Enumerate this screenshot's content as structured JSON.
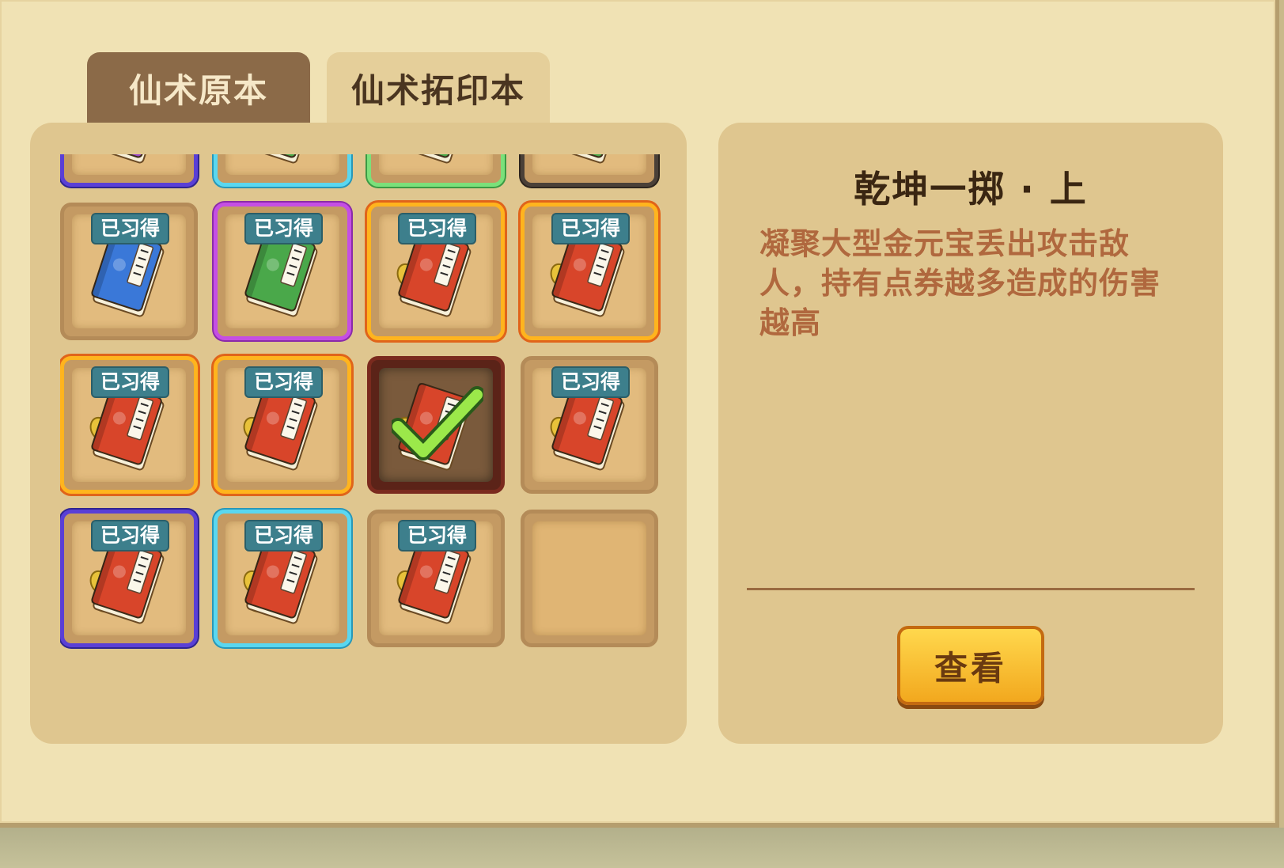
{
  "tabs": [
    {
      "label": "仙术原本",
      "active": true
    },
    {
      "label": "仙术拓印本",
      "active": false
    }
  ],
  "learned_label": "已习得",
  "grid": {
    "slots": [
      {
        "book": "purple",
        "rarity": "purple",
        "learned": false
      },
      {
        "book": "green",
        "rarity": "cyan",
        "learned": false
      },
      {
        "book": "green",
        "rarity": "green",
        "learned": false
      },
      {
        "book": "green",
        "rarity": "dark",
        "learned": false
      },
      {
        "book": "blue",
        "rarity": "none",
        "learned": true
      },
      {
        "book": "green",
        "rarity": "magenta",
        "learned": true
      },
      {
        "book": "red",
        "rarity": "gold",
        "learned": true
      },
      {
        "book": "red",
        "rarity": "gold",
        "learned": true
      },
      {
        "book": "red",
        "rarity": "gold",
        "learned": true
      },
      {
        "book": "red",
        "rarity": "gold",
        "learned": true
      },
      {
        "book": "red",
        "rarity": "none",
        "learned": false,
        "selected": true
      },
      {
        "book": "red",
        "rarity": "none",
        "learned": true
      },
      {
        "book": "red",
        "rarity": "purple",
        "learned": true
      },
      {
        "book": "red",
        "rarity": "cyan",
        "learned": true
      },
      {
        "book": "red",
        "rarity": "none",
        "learned": true
      },
      {
        "book": null,
        "rarity": "none",
        "learned": false
      }
    ]
  },
  "detail": {
    "title": "乾坤一掷 · 上",
    "description": "凝聚大型金元宝丢出攻击敌人，持有点券越多造成的伤害越高",
    "view_button_label": "查看"
  },
  "book_colors": {
    "purple": "#9a48c8",
    "green": "#4aa84a",
    "blue": "#3a78d8",
    "red": "#d8452a"
  }
}
